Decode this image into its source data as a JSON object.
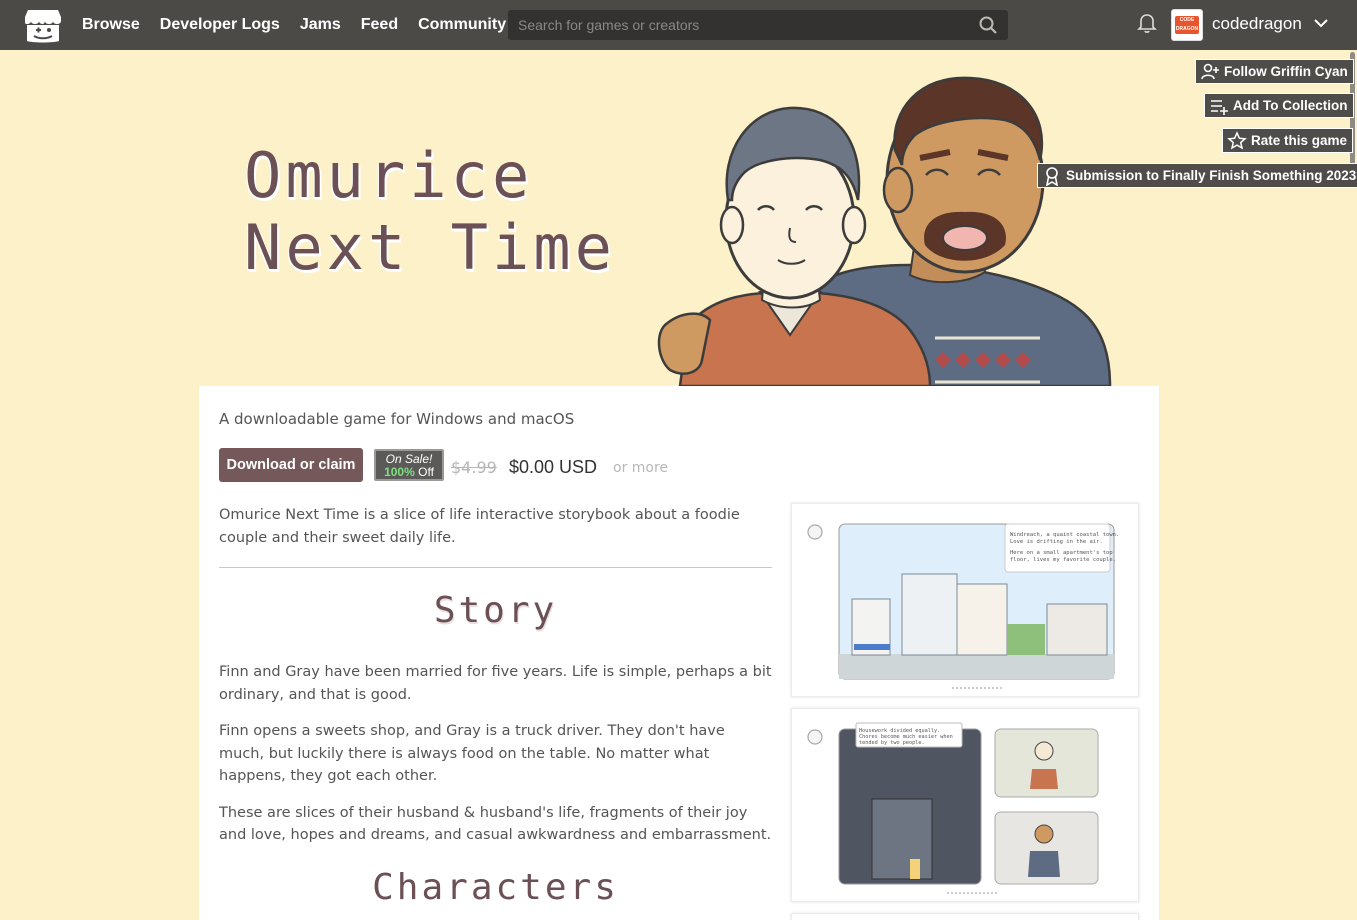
{
  "nav": {
    "items": [
      "Browse",
      "Developer Logs",
      "Jams",
      "Feed",
      "Community"
    ],
    "search_placeholder": "Search for games or creators",
    "username": "codedragon",
    "avatar_text": "CODE DRAGON"
  },
  "actions": {
    "follow": "Follow Griffin Cyan",
    "collection": "Add To Collection",
    "rate": "Rate this game",
    "submission": "Submission to Finally Finish Something 2023"
  },
  "banner": {
    "title_line1": "Omurice",
    "title_line2": "Next Time"
  },
  "game": {
    "tagline": "A downloadable game for Windows and macOS",
    "download_label": "Download or claim",
    "sale_label": "On Sale!",
    "sale_pct": "100%",
    "sale_off": "Off",
    "old_price": "$4.99",
    "new_price": "$0.00 USD",
    "or_more": "or more",
    "intro": "Omurice Next Time is a slice of life interactive storybook about a foodie couple and their sweet daily life.",
    "story_heading": "Story",
    "paragraphs": [
      "Finn and Gray have been married for five years. Life is simple, perhaps a bit ordinary, and that is good.",
      "Finn opens a sweets shop, and Gray is a truck driver. They don't have much, but luckily there is always food on the table. No matter what happens, they got each other.",
      "These are slices of their husband & husband's life, fragments of their joy and love, hopes and dreams, and casual awkwardness and embarrassment."
    ],
    "characters_heading": "Characters"
  },
  "screenshots": {
    "shot1_caption": [
      "Windreach, a quaint coastal town.",
      "Love is drifting in the air.",
      "Here on a small apartment's top",
      "floor, lives my favorite couple."
    ],
    "shot2_caption": [
      "Housework divided equally.",
      "Chores become much easier when",
      "tended by two people."
    ]
  },
  "colors": {
    "background": "#fcf1c9",
    "topbar": "#4c4a47",
    "accent_button": "#755859",
    "title_color": "#6b5156",
    "sale_green": "#7de07d"
  }
}
